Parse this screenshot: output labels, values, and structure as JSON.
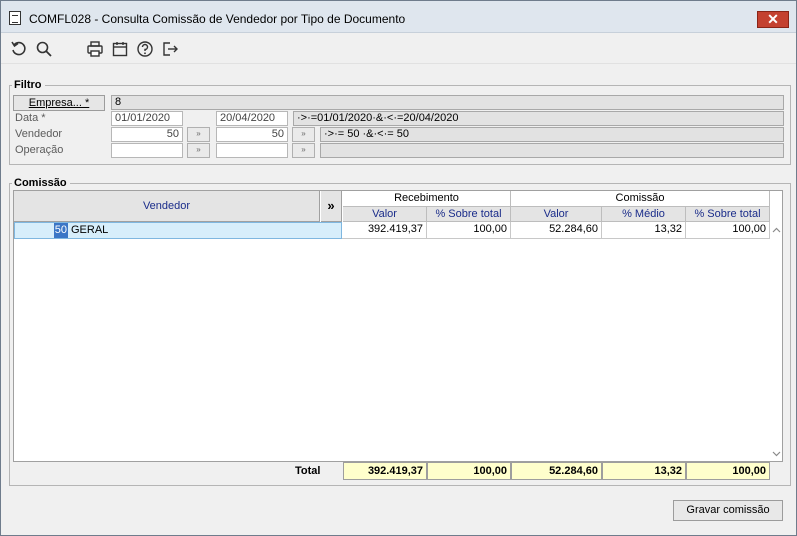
{
  "window": {
    "title": "COMFL028 - Consulta Comissão de Vendedor por Tipo de Documento",
    "close_symbol": "✕"
  },
  "toolbar": {
    "icons": [
      "refresh-icon",
      "search-icon",
      "print-icon",
      "calendar-icon",
      "help-icon",
      "exit-icon"
    ]
  },
  "filtro": {
    "legend": "Filtro",
    "empresa_button": "Empresa... *",
    "empresa_value": "8",
    "data_label": "Data *",
    "data_from": "01/01/2020",
    "data_to": "20/04/2020",
    "data_expr": "·>·=01/01/2020·&·<·=20/04/2020",
    "vendedor_label": "Vendedor",
    "vendedor_from": "50",
    "vendedor_to": "50",
    "vendedor_expr": "·>·= 50 ·&·<·= 50",
    "operacao_label": "Operação",
    "operacao_from": "",
    "operacao_to": "",
    "operacao_expr": "",
    "lookup_symbol": "»"
  },
  "comissao": {
    "legend": "Comissão",
    "headers": {
      "vendedor": "Vendedor",
      "expand": "»",
      "recebimento": "Recebimento",
      "comissao": "Comissão",
      "rec_valor": "Valor",
      "rec_pct": "% Sobre total",
      "com_valor": "Valor",
      "com_medio": "% Médio",
      "com_pct": "% Sobre total"
    },
    "rows": [
      {
        "code": "50",
        "name": "GERAL",
        "rec_valor": "392.419,37",
        "rec_pct": "100,00",
        "com_valor": "52.284,60",
        "com_medio": "13,32",
        "com_pct": "100,00"
      }
    ],
    "total": {
      "label": "Total",
      "rec_valor": "392.419,37",
      "rec_pct": "100,00",
      "com_valor": "52.284,60",
      "com_medio": "13,32",
      "com_pct": "100,00"
    }
  },
  "footer": {
    "save_button": "Gravar comissão"
  }
}
